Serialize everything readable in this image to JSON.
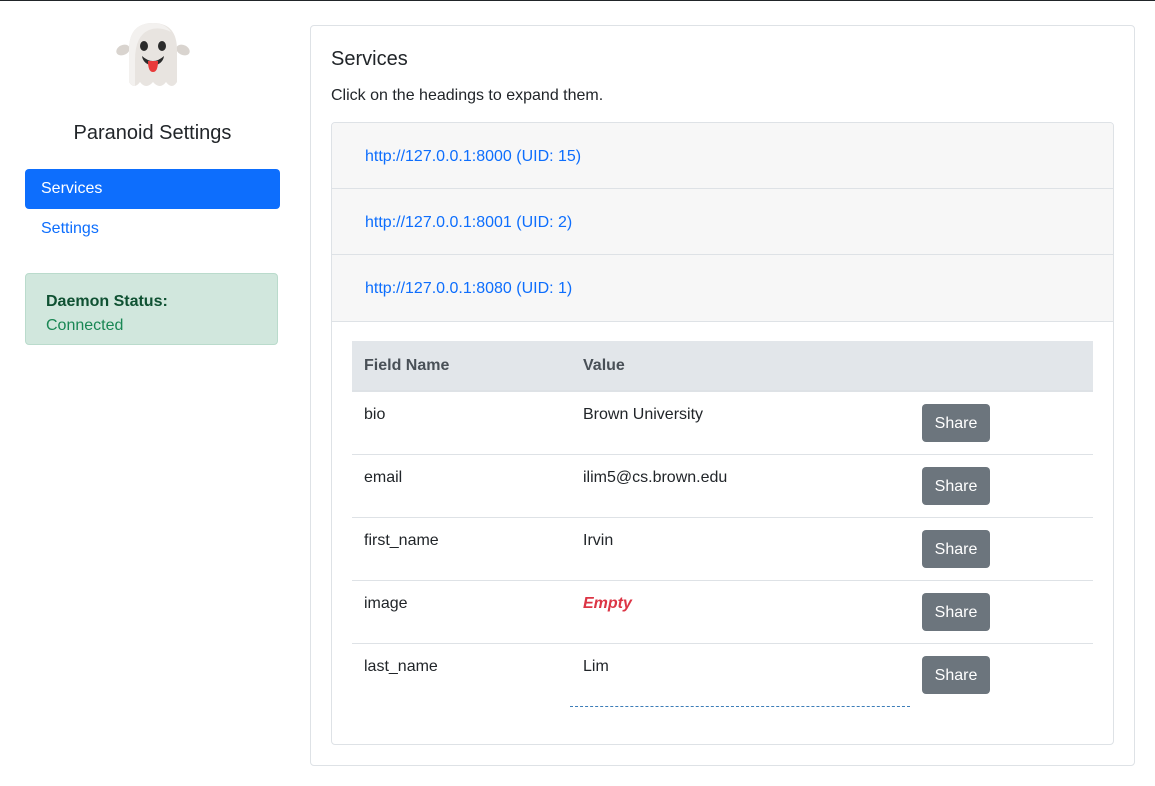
{
  "sidebar": {
    "app_title": "Paranoid Settings",
    "logo_icon": "ghost-icon",
    "nav": [
      {
        "label": "Services",
        "active": true
      },
      {
        "label": "Settings",
        "active": false
      }
    ],
    "status": {
      "label": "Daemon Status:",
      "value": "Connected"
    }
  },
  "main": {
    "title": "Services",
    "subtitle": "Click on the headings to expand them.",
    "services": [
      {
        "label": "http://127.0.0.1:8000 (UID: 15)"
      },
      {
        "label": "http://127.0.0.1:8001 (UID: 2)"
      },
      {
        "label": "http://127.0.0.1:8080 (UID: 1)"
      }
    ],
    "table": {
      "headers": [
        "Field Name",
        "Value",
        ""
      ],
      "rows": [
        {
          "field": "bio",
          "value": "Brown University",
          "action": "Share"
        },
        {
          "field": "email",
          "value": "ilim5@cs.brown.edu",
          "action": "Share"
        },
        {
          "field": "first_name",
          "value": "Irvin",
          "action": "Share"
        },
        {
          "field": "image",
          "value": "Empty",
          "action": "Share"
        },
        {
          "field": "last_name",
          "value": "Lim",
          "action": "Share"
        }
      ]
    }
  },
  "colors": {
    "primary": "#0d6efd",
    "success_bg": "#d1e7dd",
    "success_text": "#198754",
    "danger": "#dc3545",
    "secondary": "#6c757d"
  }
}
